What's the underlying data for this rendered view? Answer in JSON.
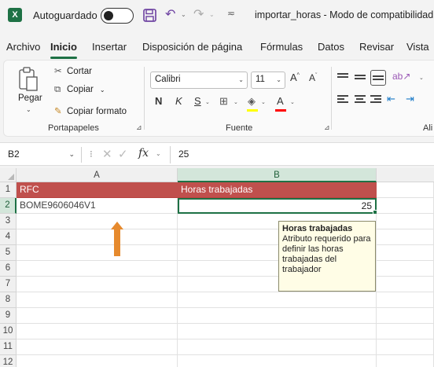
{
  "titlebar": {
    "app_logo": "X",
    "autosave_label": "Autoguardado",
    "autosave_state": "off",
    "document_title": "importar_horas - Modo de compatibilidad",
    "icons": [
      "save-icon",
      "undo-icon",
      "redo-icon",
      "customize-icon"
    ]
  },
  "menu": {
    "tabs": [
      "Archivo",
      "Inicio",
      "Insertar",
      "Disposición de página",
      "Fórmulas",
      "Datos",
      "Revisar",
      "Vista"
    ],
    "active": "Inicio"
  },
  "ribbon": {
    "clipboard": {
      "paste_label": "Pegar",
      "cut_label": "Cortar",
      "copy_label": "Copiar",
      "format_painter_label": "Copiar formato",
      "group_label": "Portapapeles"
    },
    "font": {
      "font_name": "Calibri",
      "font_size": "11",
      "grow_label": "A",
      "shrink_label": "A",
      "bold_label": "N",
      "italic_label": "K",
      "underline_label": "S",
      "font_color_label": "A",
      "group_label": "Fuente",
      "fill_color": "#ffff00",
      "font_color": "#ff0000"
    },
    "alignment": {
      "group_label": "Ali"
    }
  },
  "formula_bar": {
    "name_box": "B2",
    "fx_label": "fx",
    "value": "25"
  },
  "sheet": {
    "columns": [
      "A",
      "B"
    ],
    "rows": [
      "1",
      "2",
      "3",
      "4",
      "5",
      "6",
      "7",
      "8",
      "9",
      "10",
      "11",
      "12"
    ],
    "header_color": "#c0504d",
    "cells": {
      "A1": "RFC",
      "B1": "Horas trabajadas",
      "A2": "BOME9606046V1",
      "B2": "25"
    },
    "active_cell": "B2"
  },
  "comment": {
    "title": "Horas trabajadas",
    "body": "Atributo requerido para definir las horas trabajadas del trabajador"
  },
  "annotation": {
    "arrow_color": "#e68a2e"
  }
}
